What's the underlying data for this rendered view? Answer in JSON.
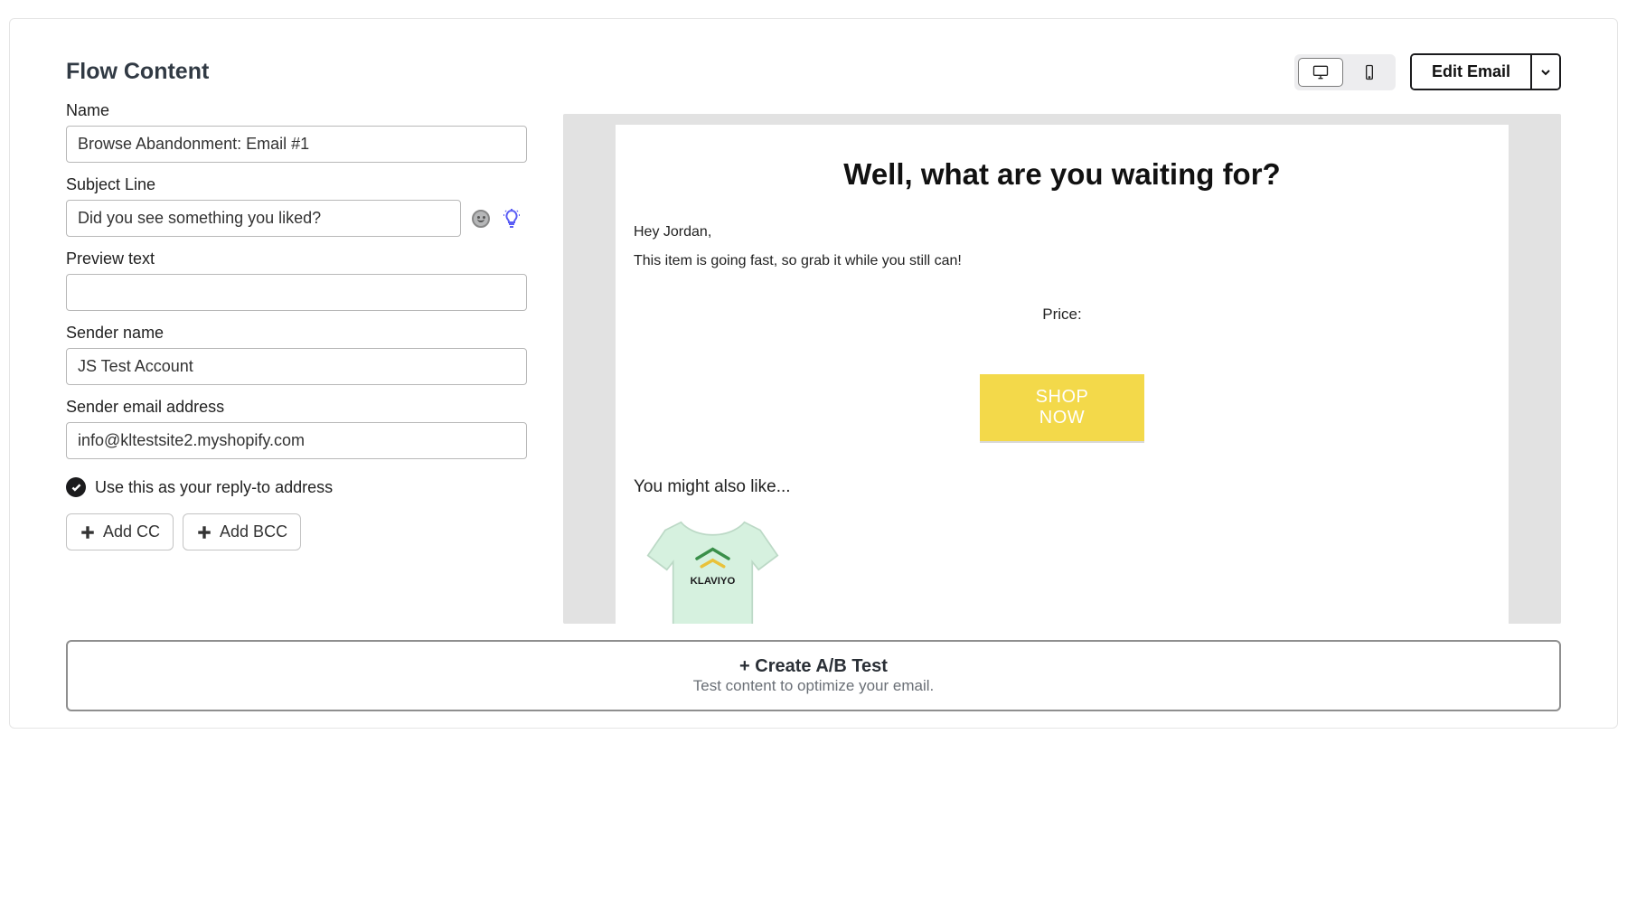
{
  "page": {
    "title": "Flow Content"
  },
  "form": {
    "name_label": "Name",
    "name_value": "Browse Abandonment: Email #1",
    "subject_label": "Subject Line",
    "subject_value": "Did you see something you liked?",
    "preview_label": "Preview text",
    "preview_value": "",
    "sender_name_label": "Sender name",
    "sender_name_value": "JS Test Account",
    "sender_email_label": "Sender email address",
    "sender_email_value": "info@kltestsite2.myshopify.com",
    "reply_to_label": "Use this as your reply-to address",
    "add_cc_label": "Add CC",
    "add_bcc_label": "Add BCC"
  },
  "toolbar": {
    "edit_label": "Edit Email"
  },
  "preview": {
    "headline": "Well, what are you waiting for?",
    "greeting": "Hey Jordan,",
    "body1": "This item is going fast, so grab it while you still can!",
    "price_label": "Price:",
    "shop_now": "SHOP NOW",
    "also_like": "You might also like...",
    "product_logo_text": "KLAVIYO"
  },
  "ab": {
    "title": "+ Create A/B Test",
    "subtitle": "Test content to optimize your email."
  }
}
